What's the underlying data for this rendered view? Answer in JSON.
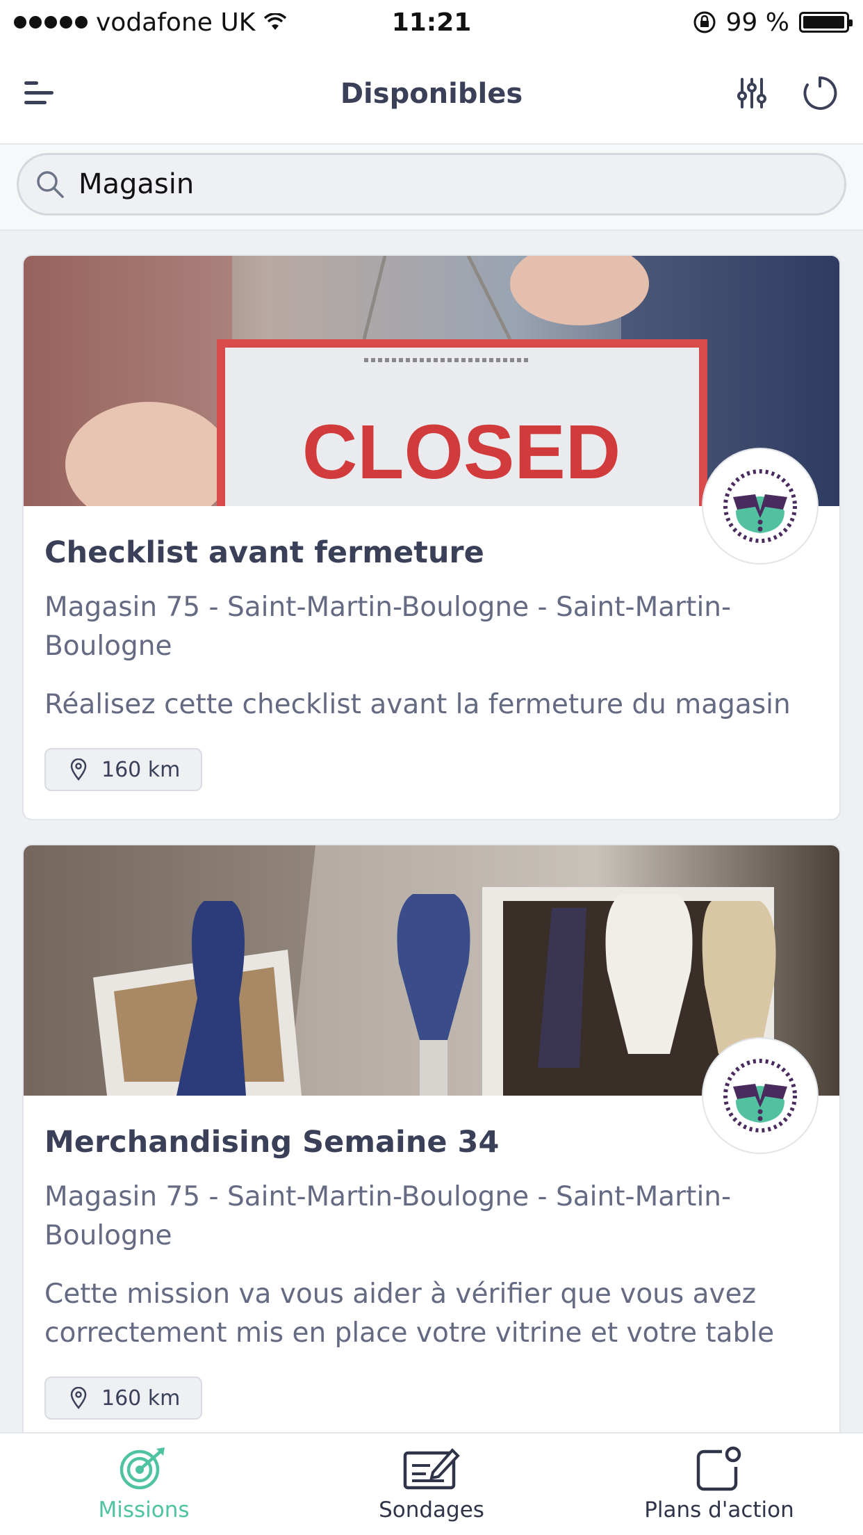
{
  "status_bar": {
    "carrier": "vodafone UK",
    "time": "11:21",
    "battery": "99 %",
    "battery_level": 0.99
  },
  "nav": {
    "title": "Disponibles",
    "menu_icon": "menu-icon",
    "filter_icon": "sliders-icon",
    "refresh_icon": "refresh-icon"
  },
  "search": {
    "value": "Magasin",
    "icon": "search-icon"
  },
  "missions": [
    {
      "title": "Checklist avant fermeture",
      "location": "Magasin 75 - Saint-Martin-Boulogne - Saint-Martin-Boulogne",
      "description": "Réalisez cette checklist avant la fermeture du magasin",
      "distance": "160 km",
      "image_sign_text": "CLOSED"
    },
    {
      "title": "Merchandising Semaine 34",
      "location": "Magasin 75 - Saint-Martin-Boulogne - Saint-Martin-Boulogne",
      "description": "Cette mission va vous aider à vérifier que vous avez correctement mis en place votre vitrine et votre table",
      "distance": "160 km"
    }
  ],
  "tabs": [
    {
      "label": "Missions",
      "icon": "target-icon",
      "active": true
    },
    {
      "label": "Sondages",
      "icon": "survey-icon",
      "active": false
    },
    {
      "label": "Plans d'action",
      "icon": "action-plan-icon",
      "active": false
    }
  ],
  "colors": {
    "accent": "#4fc3a1",
    "text_primary": "#3b4059",
    "text_secondary": "#636a82",
    "brand_purple": "#4a2b5e",
    "brand_green": "#52c1a0"
  }
}
